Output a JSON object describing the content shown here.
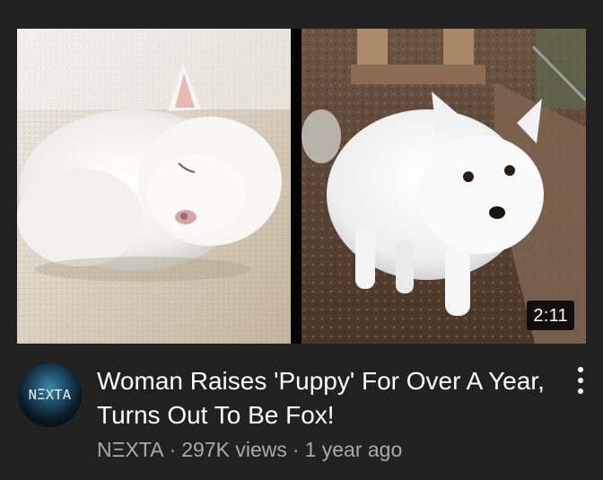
{
  "video": {
    "title": "Woman Raises 'Puppy' For Over A Year, Turns Out To Be Fox!",
    "duration": "2:11",
    "channel": "NΞXTA",
    "views": "297K views",
    "age": "1 year ago",
    "separator": "·"
  },
  "channel_avatar": {
    "logo_text": "NΞXTA"
  },
  "thumbnail": {
    "left_image": "sleeping-white-fox-photo",
    "right_image": "standing-white-fox-photo"
  },
  "icons": {
    "menu": "more-vertical-icon"
  }
}
